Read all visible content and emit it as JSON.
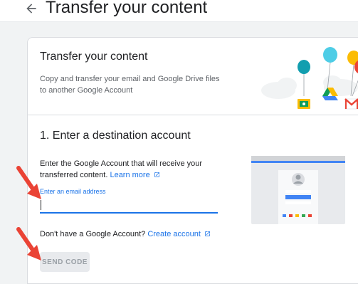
{
  "header": {
    "title": "Transfer your content"
  },
  "intro": {
    "title": "Transfer your content",
    "description": "Copy and transfer your email and Google Drive files to another Google Account"
  },
  "step": {
    "title": "1. Enter a destination account",
    "instruction": "Enter the Google Account that will receive your transferred content.",
    "learn_more": "Learn more",
    "email_label": "Enter an email address",
    "email_value": "",
    "no_account_text": "Don't have a Google Account?",
    "create_account": "Create account",
    "send_code_label": "SEND CODE"
  },
  "colors": {
    "accent": "#1a73e8",
    "arrow": "#ea4335",
    "disabled_button_bg": "#e8eaed",
    "disabled_button_text": "#9aa0a6"
  },
  "icons": [
    "back-arrow-icon",
    "external-link-icon",
    "google-classroom-icon",
    "google-drive-icon",
    "gmail-icon",
    "balloon-icon",
    "cloud-icon",
    "avatar-icon"
  ]
}
